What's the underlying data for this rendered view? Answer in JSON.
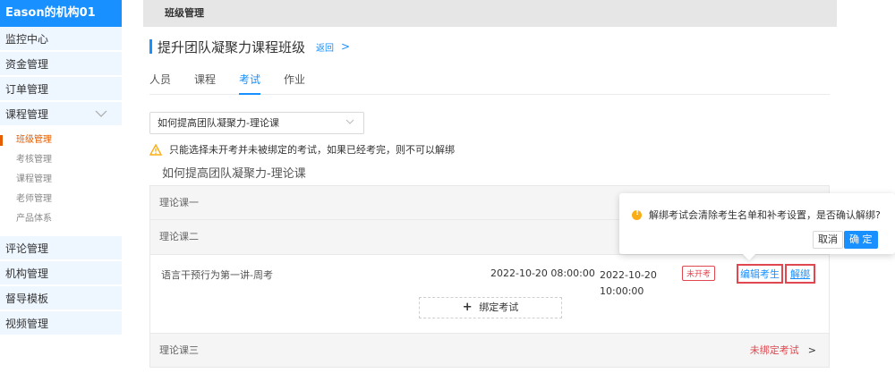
{
  "app": {
    "brand": "Eason的机构01"
  },
  "sidebar": {
    "items": [
      {
        "label": "监控中心"
      },
      {
        "label": "资金管理"
      },
      {
        "label": "订单管理"
      },
      {
        "label": "课程管理",
        "chevron": "chevron-down-icon"
      },
      {
        "label": "评论管理"
      },
      {
        "label": "机构管理"
      },
      {
        "label": "督导模板"
      },
      {
        "label": "视频管理"
      }
    ],
    "sub_items": [
      {
        "label": "班级管理",
        "active": true
      },
      {
        "label": "考核管理"
      },
      {
        "label": "课程管理"
      },
      {
        "label": "老师管理"
      },
      {
        "label": "产品体系"
      }
    ]
  },
  "header": {
    "title": "班级管理"
  },
  "page": {
    "title": "提升团队凝聚力课程班级",
    "back_label": "返回",
    "back_arrow": ">"
  },
  "tabs": [
    {
      "label": "人员"
    },
    {
      "label": "课程"
    },
    {
      "label": "考试",
      "active": true
    },
    {
      "label": "作业"
    }
  ],
  "course_select": {
    "value": "如何提高团队凝聚力-理论课"
  },
  "warning": {
    "text": "只能选择未开考并未被绑定的考试，如果已经考完，则不可以解绑"
  },
  "course_name": "如何提高团队凝聚力-理论课",
  "lessons": [
    {
      "name": "理论课一"
    },
    {
      "name": "理论课二"
    },
    {
      "name": "理论课三",
      "status": "未绑定考试",
      "arrow": ">"
    }
  ],
  "exam": {
    "name": "语言干预行为第一讲-周考",
    "start": "2022-10-20 08:00:00",
    "end_date": "2022-10-20",
    "end_time": "10:00:00",
    "status": "未开考",
    "edit_label": "编辑考生",
    "unbind_label": "解绑"
  },
  "bind_button": {
    "plus": "+",
    "label": "绑定考试"
  },
  "popconfirm": {
    "message": "解绑考试会清除考生名单和补考设置，是否确认解绑?",
    "cancel_label": "取消",
    "ok_label": "确 定"
  },
  "colors": {
    "primary": "#1890ff",
    "danger": "#e0474f",
    "warning": "#faad14",
    "active_sub": "#e65c00"
  }
}
